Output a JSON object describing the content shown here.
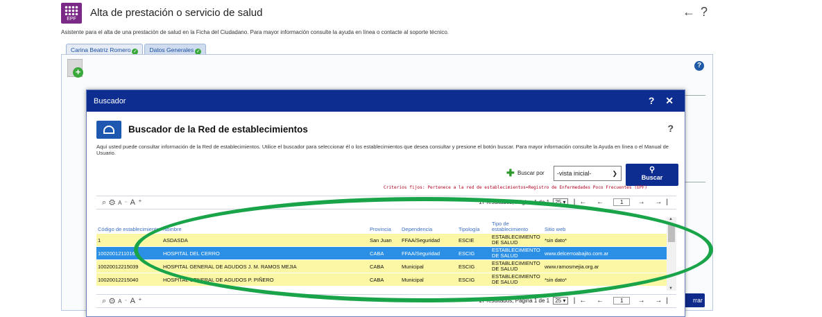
{
  "app": {
    "logo_text": "EPF",
    "title": "Alta de prestación o servicio de salud",
    "header_back": "←",
    "header_help": "?",
    "description": "Asistente para el alta de una prestación de salud en la Ficha del Ciudadano. Para mayor información consulte la ayuda en línea o contacte al soporte técnico.",
    "tabs": [
      {
        "label": "Carina Beatriz Romero"
      },
      {
        "label": "Datos Generales"
      }
    ],
    "help_label": "?",
    "cerrar_label": "rrar"
  },
  "modal": {
    "title": "Buscador",
    "controls": "? ✕",
    "search_title": "Buscador de la Red de establecimientos",
    "search_help": "?",
    "search_description": "Aquí usted puede consultar información de la Red de establecimientos. Utilice el buscador para seleccionar él o los establecimientos que desea consultar y presione el botón buscar. Para mayor información consulte la Ayuda en línea o el Manual de Usuario.",
    "buscar_por_label": "Buscar por",
    "select_value": "-vista inicial-",
    "buscar_button": "Buscar",
    "criterios": "Criterios fijos: Pertenece a la red de establecimientos=Registro de Enfermedades Poco Frecuentes (EPF)",
    "toolbar_top": {
      "results_text": "17 resultados, Página 1 de 1",
      "page_size": "25",
      "page_num": "1"
    },
    "toolbar_bottom": {
      "results_text": "17 resultados, Página 1 de 1",
      "page_size": "25",
      "page_num": "1"
    },
    "columns": {
      "codigo": "Código de establecimiento",
      "nombre": "Nombre",
      "provincia": "Provincia",
      "dependencia": "Dependencia",
      "tipologia": "Tipología",
      "tipo": "Tipo de establecimiento",
      "sitio": "Sitio web"
    },
    "rows": [
      {
        "codigo": "1",
        "nombre": "ASDASDA",
        "provincia": "San Juan",
        "dependencia": "FFAA/Seguridad",
        "tipologia": "ESCIE",
        "tipo": "ESTABLECIMIENTO DE SALUD",
        "sitio": "*sin dato*"
      },
      {
        "codigo": "10020012110168",
        "nombre": "HOSPITAL DEL CERRO",
        "provincia": "CABA",
        "dependencia": "FFAA/Seguridad",
        "tipologia": "ESCIG",
        "tipo": "ESTABLECIMIENTO DE SALUD",
        "sitio": "www.delcerroabajito.com.ar"
      },
      {
        "codigo": "10020012215039",
        "nombre": "HOSPITAL GENERAL DE AGUDOS J. M. RAMOS MEJIA",
        "provincia": "CABA",
        "dependencia": "Municipal",
        "tipologia": "ESCIG",
        "tipo": "ESTABLECIMIENTO DE SALUD",
        "sitio": "www.ramosmejia.org.ar"
      },
      {
        "codigo": "10020012215040",
        "nombre": "HOSPITAL GENERAL DE AGUDOS P. PIÑERO",
        "provincia": "CABA",
        "dependencia": "Municipal",
        "tipologia": "ESCIG",
        "tipo": "ESTABLECIMIENTO DE SALUD",
        "sitio": "*sin dato*"
      }
    ]
  },
  "colors": {
    "brand_purple": "#7a2a86",
    "modal_header": "#0d2d91",
    "row_highlight": "#fbf7a5",
    "row_selected": "#2b8fe5",
    "annotation_green": "#1aa44a",
    "criterios_red": "#b00020"
  },
  "icons": [
    "epf-logo-icon",
    "back-arrow-icon",
    "help-icon",
    "check-icon",
    "document-add-icon",
    "close-icon",
    "house-icon",
    "plus-icon",
    "chevron-down-icon",
    "search-icon",
    "zoom-icon",
    "gear-icon",
    "font-smaller-icon",
    "font-larger-icon",
    "first-page-icon",
    "prev-page-icon",
    "next-page-icon",
    "last-page-icon"
  ]
}
